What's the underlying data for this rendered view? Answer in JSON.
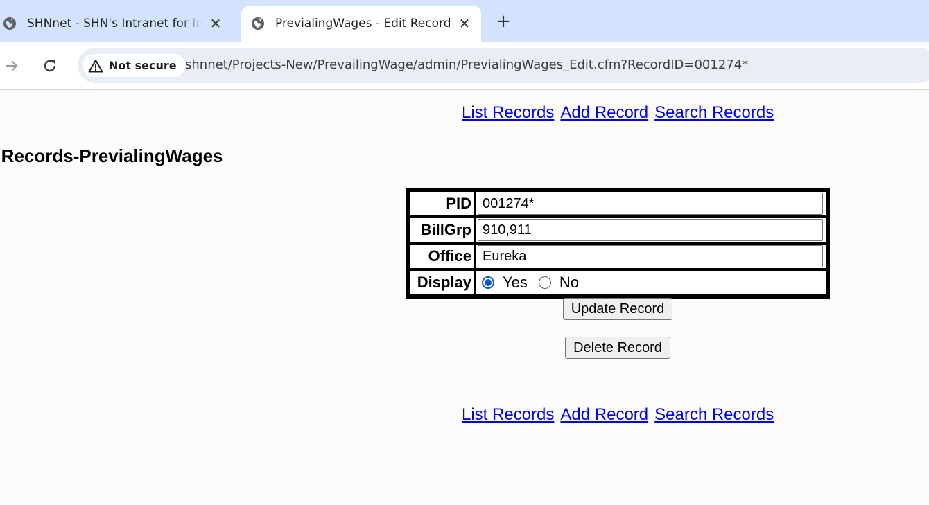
{
  "browser": {
    "tabs": [
      {
        "title": "SHNnet - SHN's Intranet for Info",
        "active": false,
        "icon": "globe-icon"
      },
      {
        "title": "PrevialingWages - Edit Record",
        "active": true,
        "icon": "globe-icon"
      }
    ],
    "close_glyph": "✕",
    "new_tab_glyph": "+",
    "security_label": "Not secure",
    "url": "shnnet/Projects-New/PrevailingWage/admin/PrevialingWages_Edit.cfm?RecordID=001274*"
  },
  "page": {
    "nav_links": {
      "list": "List Records",
      "add": "Add Record",
      "search": "Search Records"
    },
    "heading": "s Records-PrevialingWages",
    "form": {
      "pid_label": "PID",
      "pid_value": "001274*",
      "billgrp_label": "BillGrp",
      "billgrp_value": "910,911",
      "office_label": "Office",
      "office_value": "Eureka",
      "display_label": "Display",
      "display_yes": "Yes",
      "display_no": "No",
      "display_selected": "Yes"
    },
    "buttons": {
      "update": "Update Record",
      "delete": "Delete Record"
    }
  },
  "colors": {
    "tabstrip": "#d3e3fd",
    "link": "#0000ee",
    "radio_accent": "#0b57d0"
  }
}
